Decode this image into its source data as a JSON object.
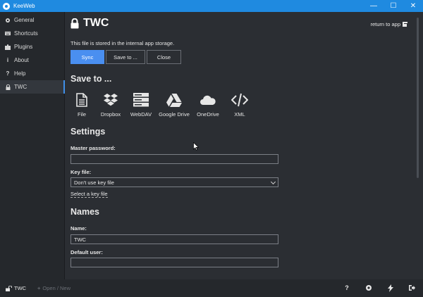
{
  "window": {
    "title": "KeeWeb"
  },
  "sidebar": {
    "items": [
      {
        "label": "General",
        "icon": "gear-icon"
      },
      {
        "label": "Shortcuts",
        "icon": "keyboard-icon"
      },
      {
        "label": "Plugins",
        "icon": "puzzle-icon"
      },
      {
        "label": "About",
        "icon": "info-icon"
      },
      {
        "label": "Help",
        "icon": "question-icon"
      },
      {
        "label": "TWC",
        "icon": "lock-icon",
        "active": true
      }
    ]
  },
  "header": {
    "title": "TWC",
    "return_label": "return to app"
  },
  "info_text": "This file is stored in the internal app storage.",
  "buttons": {
    "sync": "Sync",
    "save_to": "Save to ...",
    "close": "Close"
  },
  "save_to": {
    "heading": "Save to ...",
    "options": [
      {
        "label": "File",
        "icon": "file-icon"
      },
      {
        "label": "Dropbox",
        "icon": "dropbox-icon"
      },
      {
        "label": "WebDAV",
        "icon": "server-icon"
      },
      {
        "label": "Google Drive",
        "icon": "google-drive-icon"
      },
      {
        "label": "OneDrive",
        "icon": "cloud-icon"
      },
      {
        "label": "XML",
        "icon": "code-icon"
      }
    ]
  },
  "settings": {
    "heading": "Settings",
    "master_password_label": "Master password:",
    "master_password_value": "",
    "key_file_label": "Key file:",
    "key_file_selected": "Don't use key file",
    "select_key_file_link": "Select a key file"
  },
  "names": {
    "heading": "Names",
    "name_label": "Name:",
    "name_value": "TWC",
    "default_user_label": "Default user:",
    "default_user_value": ""
  },
  "footer": {
    "file_label": "TWC",
    "open_new_label": "Open / New"
  },
  "colors": {
    "accent": "#1f8ae0",
    "primary_button": "#4a8ff0",
    "background": "#2b2e33",
    "sidebar": "#25282c"
  }
}
